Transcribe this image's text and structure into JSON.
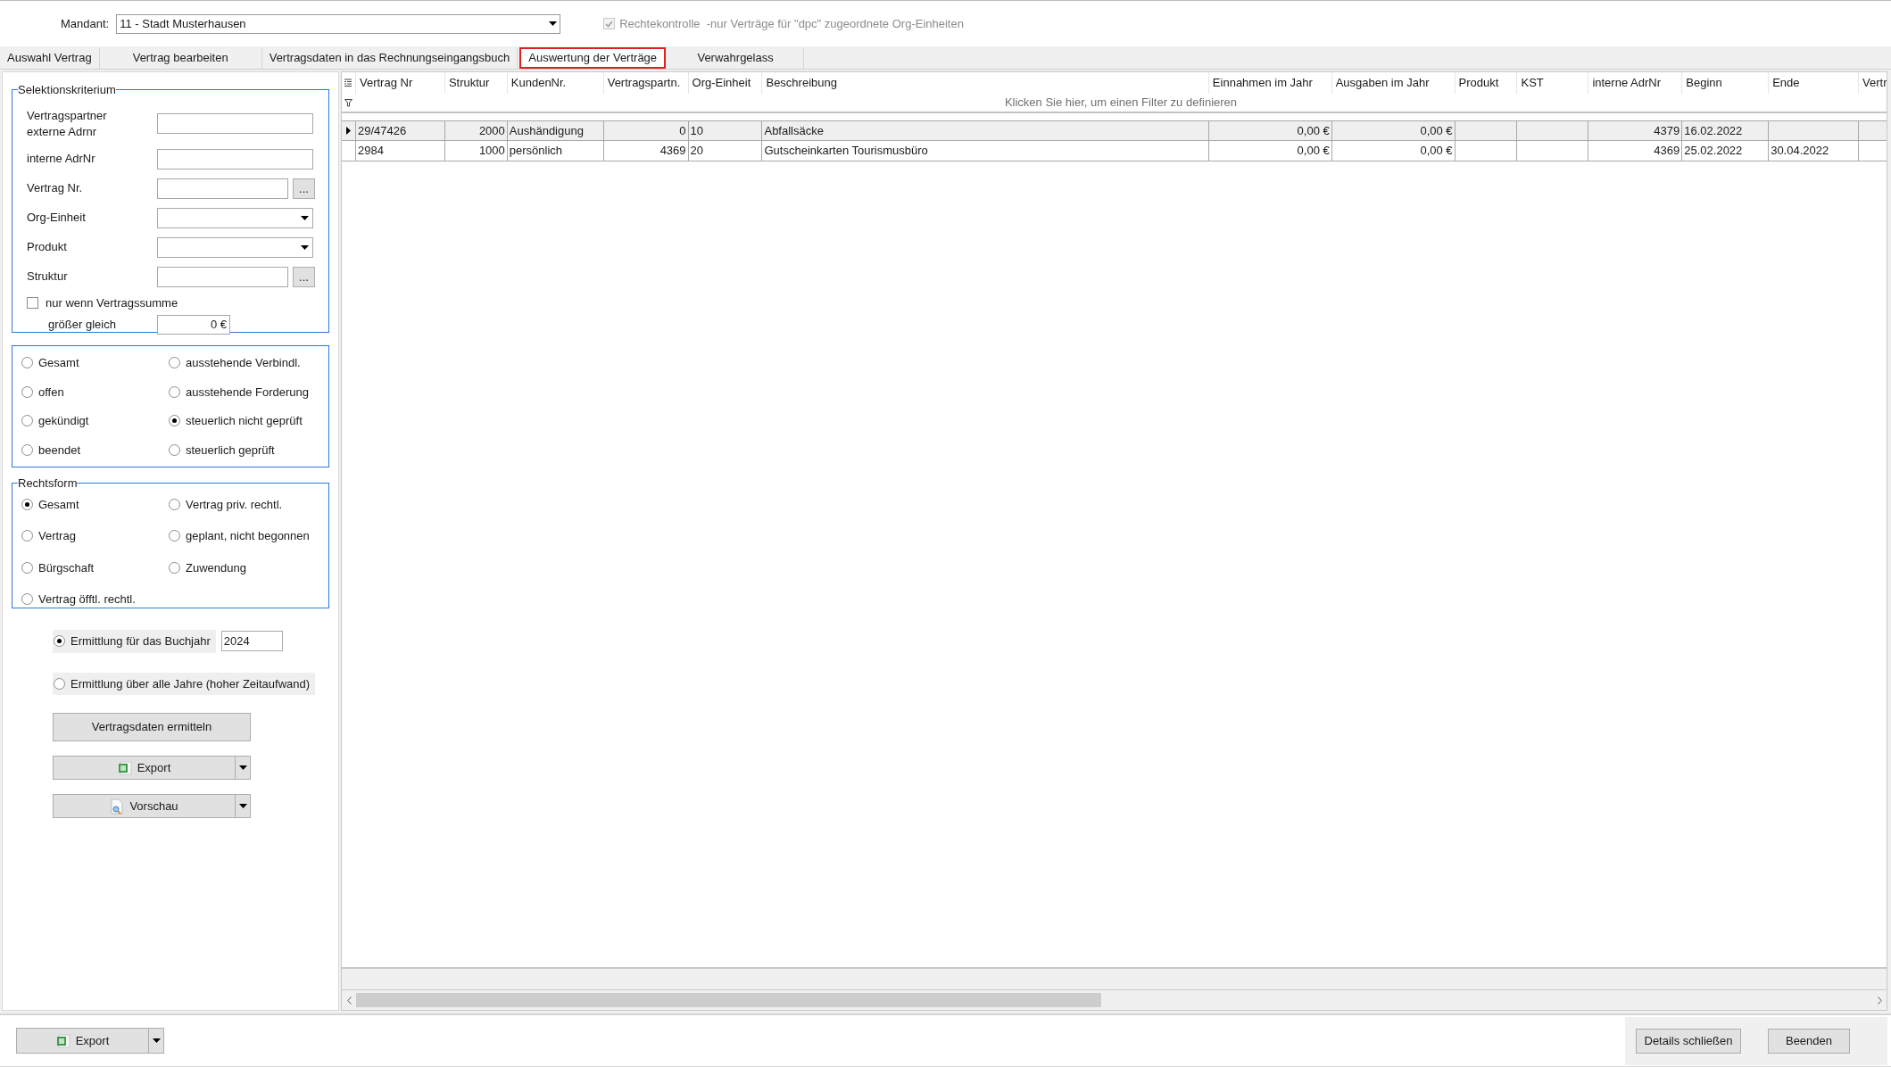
{
  "mandant": {
    "label": "Mandant:",
    "value": "11 - Stadt Musterhausen"
  },
  "rights_check": {
    "label": "Rechtekontrolle  -nur Verträge für \"dpc\" zugeordnete Org-Einheiten",
    "checked": true,
    "disabled": true
  },
  "tabs": [
    {
      "label": "Auswahl Vertrag",
      "selected": false
    },
    {
      "label": "Vertrag bearbeiten",
      "selected": false
    },
    {
      "label": "Vertragsdaten in das Rechnungseingangsbuch",
      "selected": false
    },
    {
      "label": "Auswertung der Verträge",
      "selected": true
    },
    {
      "label": "Verwahrgelass",
      "selected": false
    }
  ],
  "selection": {
    "title": "Selektionskriterium",
    "fields": [
      {
        "label": "Vertragspartner externe Adrnr",
        "kind": "text"
      },
      {
        "label": "interne AdrNr",
        "kind": "text"
      },
      {
        "label": "Vertrag Nr.",
        "kind": "picker",
        "button": "..."
      },
      {
        "label": "Org-Einheit",
        "kind": "dropdown"
      },
      {
        "label": "Produkt",
        "kind": "dropdown"
      },
      {
        "label": "Struktur",
        "kind": "picker",
        "button": "..."
      }
    ],
    "sum_filter": {
      "label": "nur wenn Vertragssumme",
      "checked": false,
      "sublabel": "größer gleich",
      "value": "0 €"
    }
  },
  "status_options": [
    {
      "label": "Gesamt",
      "selected": false
    },
    {
      "label": "ausstehende Verbindl.",
      "selected": false
    },
    {
      "label": "offen",
      "selected": false
    },
    {
      "label": "ausstehende Forderung",
      "selected": false
    },
    {
      "label": "gekündigt",
      "selected": false
    },
    {
      "label": "steuerlich nicht geprüft",
      "selected": true
    },
    {
      "label": "beendet",
      "selected": false
    },
    {
      "label": "steuerlich geprüft",
      "selected": false
    }
  ],
  "legal_form": {
    "title": "Rechtsform",
    "options": [
      {
        "label": "Gesamt",
        "selected": true
      },
      {
        "label": "Vertrag priv. rechtl.",
        "selected": false
      },
      {
        "label": "Vertrag",
        "selected": false
      },
      {
        "label": "geplant, nicht begonnen",
        "selected": false
      },
      {
        "label": "Bürgschaft",
        "selected": false
      },
      {
        "label": "Zuwendung",
        "selected": false
      },
      {
        "label": "Vertrag öfftl. rechtl.",
        "selected": false
      }
    ]
  },
  "period_options": [
    {
      "label": "Ermittlung für das Buchjahr",
      "selected": true,
      "year": "2024"
    },
    {
      "label": "Ermittlung über alle Jahre (hoher Zeitaufwand)",
      "selected": false
    }
  ],
  "actions": [
    {
      "label": "Vertragsdaten ermitteln",
      "kind": "plain"
    },
    {
      "label": "Export",
      "kind": "export"
    },
    {
      "label": "Vorschau",
      "kind": "preview"
    }
  ],
  "table": {
    "columns": [
      "Vertrag Nr",
      "Struktur",
      "KundenNr.",
      "Vertragspartn.",
      "Org-Einheit",
      "Beschreibung",
      "Einnahmen im Jahr",
      "Ausgaben im Jahr",
      "Produkt",
      "KST",
      "interne AdrNr",
      "Beginn",
      "Ende",
      "Vertr"
    ],
    "filter_hint": "Klicken Sie hier, um einen Filter zu definieren",
    "rows": [
      {
        "selected": true,
        "cells": [
          "29/47426",
          "2000",
          "Aushändigung",
          "0",
          "10",
          "Abfallsäcke",
          "0,00 €",
          "0,00 €",
          null,
          null,
          "4379",
          "16.02.2022",
          null,
          null
        ]
      },
      {
        "selected": false,
        "cells": [
          "2984",
          "1000",
          "persönlich",
          "4369",
          "20",
          "Gutscheinkarten Tourismusbüro",
          "0,00 €",
          "0,00 €",
          null,
          null,
          "4369",
          "25.02.2022",
          "30.04.2022",
          null
        ]
      }
    ]
  },
  "footer": {
    "export": "Export",
    "buttons": [
      "Details schließen",
      "Beenden"
    ]
  }
}
